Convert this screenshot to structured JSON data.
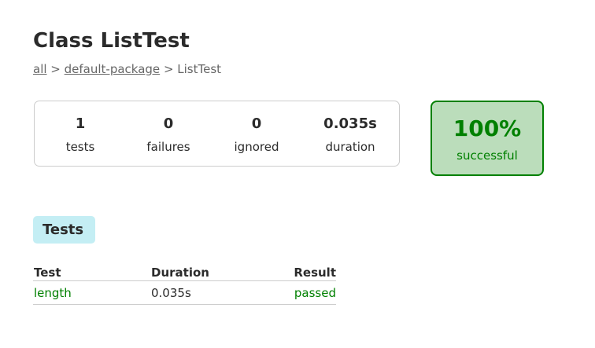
{
  "page": {
    "title": "Class ListTest"
  },
  "breadcrumb": {
    "all": "all",
    "sep1": " > ",
    "package": "default-package",
    "sep2": " > ",
    "current": "ListTest"
  },
  "summary": {
    "tests": {
      "value": "1",
      "label": "tests"
    },
    "failures": {
      "value": "0",
      "label": "failures"
    },
    "ignored": {
      "value": "0",
      "label": "ignored"
    },
    "duration": {
      "value": "0.035s",
      "label": "duration"
    }
  },
  "success": {
    "percent": "100%",
    "label": "successful",
    "color": "#008000",
    "background": "#bbddbb"
  },
  "tabs": {
    "tests_label": "Tests"
  },
  "table": {
    "headers": [
      "Test",
      "Duration",
      "Result"
    ],
    "rows": [
      {
        "test": "length",
        "duration": "0.035s",
        "result": "passed"
      }
    ]
  }
}
